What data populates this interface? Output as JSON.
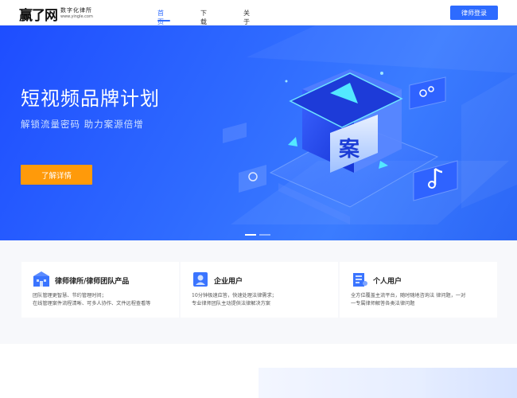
{
  "logo": {
    "mark": "赢了网",
    "tagline": "数字化律所",
    "domain": "www.yingle.com"
  },
  "nav": {
    "items": [
      {
        "label": "首页",
        "active": true
      },
      {
        "label": "下载",
        "active": false
      },
      {
        "label": "关于我们",
        "active": false
      }
    ],
    "login_label": "律师登录"
  },
  "hero": {
    "title": "短视频品牌计划",
    "subtitle": "解锁流量密码 助力案源倍增",
    "cta_label": "了解详情",
    "art_glyph": "案",
    "slides": 2,
    "active_slide": 0
  },
  "features": [
    {
      "title": "律师律所/律师团队产品",
      "icon": "building-icon",
      "lines": [
        "团队管理更智慧、节约管理时间；",
        "在线管理案件流程清晰、可多人协作、文件远程查看等"
      ]
    },
    {
      "title": "企业用户",
      "icon": "enterprise-user-icon",
      "lines": [
        "10分钟极速应答，快速处理法律需求；",
        "专业律师团队主动提供法律解决方案"
      ]
    },
    {
      "title": "个人用户",
      "icon": "personal-user-icon",
      "lines": [
        "全方位覆盖主流平台，随时随地咨询法 律问题，一对",
        "一专属律师解答各类法律问题"
      ]
    }
  ],
  "colors": {
    "accent": "#2d6bff",
    "cta": "#ff9a0a",
    "hero_bg": "#2f6bff"
  }
}
